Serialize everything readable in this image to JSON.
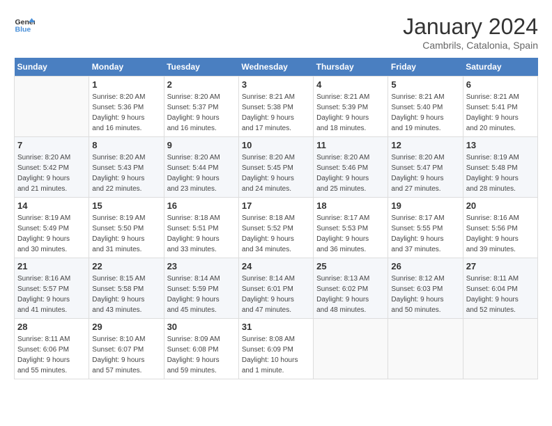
{
  "header": {
    "logo_line1": "General",
    "logo_line2": "Blue",
    "month": "January 2024",
    "location": "Cambrils, Catalonia, Spain"
  },
  "days_of_week": [
    "Sunday",
    "Monday",
    "Tuesday",
    "Wednesday",
    "Thursday",
    "Friday",
    "Saturday"
  ],
  "weeks": [
    [
      {
        "day": "",
        "info": ""
      },
      {
        "day": "1",
        "info": "Sunrise: 8:20 AM\nSunset: 5:36 PM\nDaylight: 9 hours\nand 16 minutes."
      },
      {
        "day": "2",
        "info": "Sunrise: 8:20 AM\nSunset: 5:37 PM\nDaylight: 9 hours\nand 16 minutes."
      },
      {
        "day": "3",
        "info": "Sunrise: 8:21 AM\nSunset: 5:38 PM\nDaylight: 9 hours\nand 17 minutes."
      },
      {
        "day": "4",
        "info": "Sunrise: 8:21 AM\nSunset: 5:39 PM\nDaylight: 9 hours\nand 18 minutes."
      },
      {
        "day": "5",
        "info": "Sunrise: 8:21 AM\nSunset: 5:40 PM\nDaylight: 9 hours\nand 19 minutes."
      },
      {
        "day": "6",
        "info": "Sunrise: 8:21 AM\nSunset: 5:41 PM\nDaylight: 9 hours\nand 20 minutes."
      }
    ],
    [
      {
        "day": "7",
        "info": "Sunrise: 8:20 AM\nSunset: 5:42 PM\nDaylight: 9 hours\nand 21 minutes."
      },
      {
        "day": "8",
        "info": "Sunrise: 8:20 AM\nSunset: 5:43 PM\nDaylight: 9 hours\nand 22 minutes."
      },
      {
        "day": "9",
        "info": "Sunrise: 8:20 AM\nSunset: 5:44 PM\nDaylight: 9 hours\nand 23 minutes."
      },
      {
        "day": "10",
        "info": "Sunrise: 8:20 AM\nSunset: 5:45 PM\nDaylight: 9 hours\nand 24 minutes."
      },
      {
        "day": "11",
        "info": "Sunrise: 8:20 AM\nSunset: 5:46 PM\nDaylight: 9 hours\nand 25 minutes."
      },
      {
        "day": "12",
        "info": "Sunrise: 8:20 AM\nSunset: 5:47 PM\nDaylight: 9 hours\nand 27 minutes."
      },
      {
        "day": "13",
        "info": "Sunrise: 8:19 AM\nSunset: 5:48 PM\nDaylight: 9 hours\nand 28 minutes."
      }
    ],
    [
      {
        "day": "14",
        "info": "Sunrise: 8:19 AM\nSunset: 5:49 PM\nDaylight: 9 hours\nand 30 minutes."
      },
      {
        "day": "15",
        "info": "Sunrise: 8:19 AM\nSunset: 5:50 PM\nDaylight: 9 hours\nand 31 minutes."
      },
      {
        "day": "16",
        "info": "Sunrise: 8:18 AM\nSunset: 5:51 PM\nDaylight: 9 hours\nand 33 minutes."
      },
      {
        "day": "17",
        "info": "Sunrise: 8:18 AM\nSunset: 5:52 PM\nDaylight: 9 hours\nand 34 minutes."
      },
      {
        "day": "18",
        "info": "Sunrise: 8:17 AM\nSunset: 5:53 PM\nDaylight: 9 hours\nand 36 minutes."
      },
      {
        "day": "19",
        "info": "Sunrise: 8:17 AM\nSunset: 5:55 PM\nDaylight: 9 hours\nand 37 minutes."
      },
      {
        "day": "20",
        "info": "Sunrise: 8:16 AM\nSunset: 5:56 PM\nDaylight: 9 hours\nand 39 minutes."
      }
    ],
    [
      {
        "day": "21",
        "info": "Sunrise: 8:16 AM\nSunset: 5:57 PM\nDaylight: 9 hours\nand 41 minutes."
      },
      {
        "day": "22",
        "info": "Sunrise: 8:15 AM\nSunset: 5:58 PM\nDaylight: 9 hours\nand 43 minutes."
      },
      {
        "day": "23",
        "info": "Sunrise: 8:14 AM\nSunset: 5:59 PM\nDaylight: 9 hours\nand 45 minutes."
      },
      {
        "day": "24",
        "info": "Sunrise: 8:14 AM\nSunset: 6:01 PM\nDaylight: 9 hours\nand 47 minutes."
      },
      {
        "day": "25",
        "info": "Sunrise: 8:13 AM\nSunset: 6:02 PM\nDaylight: 9 hours\nand 48 minutes."
      },
      {
        "day": "26",
        "info": "Sunrise: 8:12 AM\nSunset: 6:03 PM\nDaylight: 9 hours\nand 50 minutes."
      },
      {
        "day": "27",
        "info": "Sunrise: 8:11 AM\nSunset: 6:04 PM\nDaylight: 9 hours\nand 52 minutes."
      }
    ],
    [
      {
        "day": "28",
        "info": "Sunrise: 8:11 AM\nSunset: 6:06 PM\nDaylight: 9 hours\nand 55 minutes."
      },
      {
        "day": "29",
        "info": "Sunrise: 8:10 AM\nSunset: 6:07 PM\nDaylight: 9 hours\nand 57 minutes."
      },
      {
        "day": "30",
        "info": "Sunrise: 8:09 AM\nSunset: 6:08 PM\nDaylight: 9 hours\nand 59 minutes."
      },
      {
        "day": "31",
        "info": "Sunrise: 8:08 AM\nSunset: 6:09 PM\nDaylight: 10 hours\nand 1 minute."
      },
      {
        "day": "",
        "info": ""
      },
      {
        "day": "",
        "info": ""
      },
      {
        "day": "",
        "info": ""
      }
    ]
  ]
}
